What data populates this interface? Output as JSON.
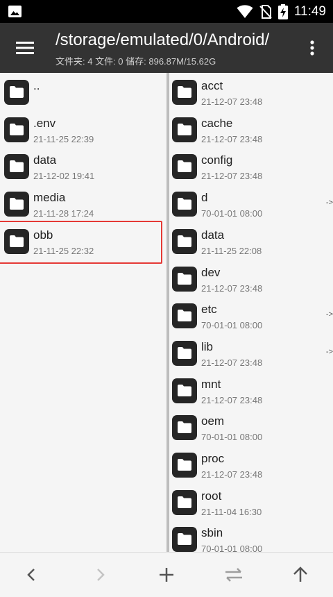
{
  "status_bar": {
    "time": "11:49"
  },
  "toolbar": {
    "path": "/storage/emulated/0/Android/",
    "info": "文件夹: 4  文件: 0  储存: 896.87M/15.62G"
  },
  "left_pane": {
    "items": [
      {
        "name": "..",
        "date": ""
      },
      {
        "name": ".env",
        "date": "21-11-25 22:39"
      },
      {
        "name": "data",
        "date": "21-12-02 19:41"
      },
      {
        "name": "media",
        "date": "21-11-28 17:24"
      },
      {
        "name": "obb",
        "date": "21-11-25 22:32"
      }
    ],
    "highlighted": "obb"
  },
  "right_pane": {
    "items": [
      {
        "name": "acct",
        "date": "21-12-07 23:48",
        "link": ""
      },
      {
        "name": "cache",
        "date": "21-12-07 23:48",
        "link": ""
      },
      {
        "name": "config",
        "date": "21-12-07 23:48",
        "link": ""
      },
      {
        "name": "d",
        "date": "70-01-01 08:00",
        "link": "->"
      },
      {
        "name": "data",
        "date": "21-11-25 22:08",
        "link": ""
      },
      {
        "name": "dev",
        "date": "21-12-07 23:48",
        "link": ""
      },
      {
        "name": "etc",
        "date": "70-01-01 08:00",
        "link": "->"
      },
      {
        "name": "lib",
        "date": "21-12-07 23:48",
        "link": "->"
      },
      {
        "name": "mnt",
        "date": "21-12-07 23:48",
        "link": ""
      },
      {
        "name": "oem",
        "date": "70-01-01 08:00",
        "link": ""
      },
      {
        "name": "proc",
        "date": "21-12-07 23:48",
        "link": ""
      },
      {
        "name": "root",
        "date": "21-11-04 16:30",
        "link": ""
      },
      {
        "name": "sbin",
        "date": "70-01-01 08:00",
        "link": ""
      }
    ]
  },
  "bottom_bar": {
    "icons": [
      "back-icon",
      "forward-icon",
      "add-icon",
      "swap-icon",
      "up-icon"
    ]
  },
  "colors": {
    "toolbar": "#333333",
    "folder_tile": "#262626",
    "selection": "#e53935"
  }
}
